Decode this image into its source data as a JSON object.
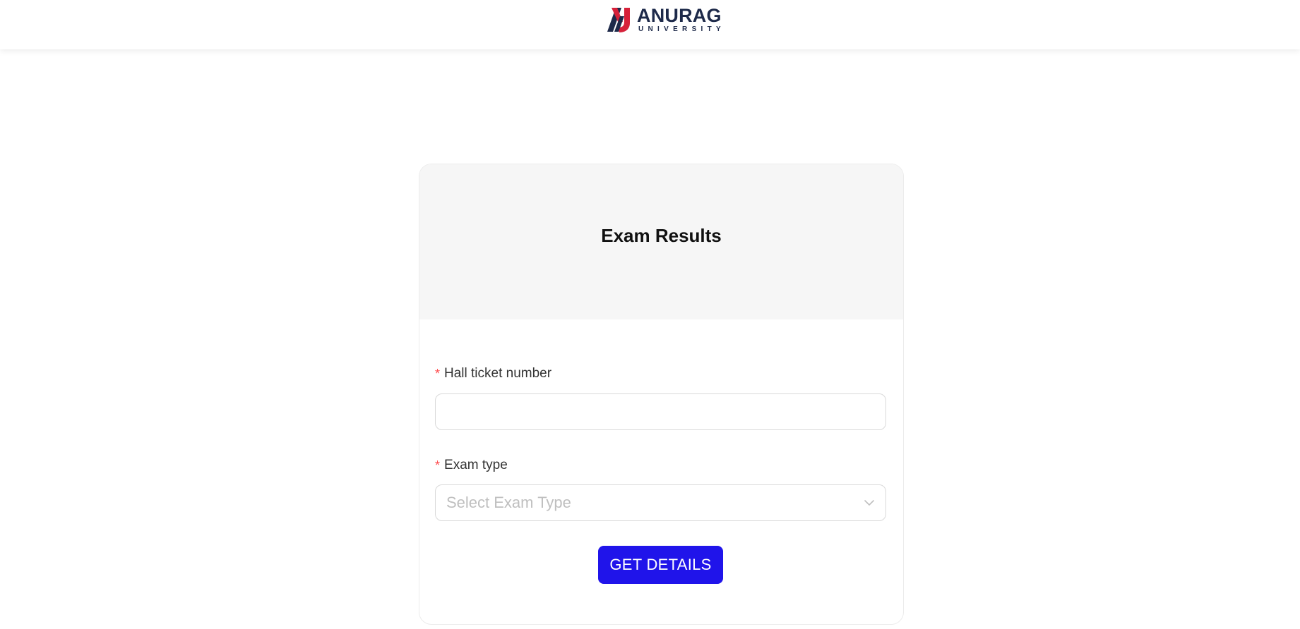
{
  "header": {
    "logo_word": "ANURAG",
    "logo_sub": "UNIVERSITY",
    "logo_colors": {
      "navy": "#1e2a4a",
      "red": "#d6213a"
    }
  },
  "card": {
    "title": "Exam Results"
  },
  "form": {
    "hall_ticket": {
      "required_mark": "*",
      "label": "Hall ticket number",
      "value": ""
    },
    "exam_type": {
      "required_mark": "*",
      "label": "Exam type",
      "placeholder": "Select Exam Type",
      "icon": "chevron-down-icon"
    },
    "submit_label": "GET DETAILS"
  },
  "colors": {
    "primary_button": "#2014ea",
    "required": "#ff4d4f",
    "card_header_bg": "#f6f6f6"
  }
}
